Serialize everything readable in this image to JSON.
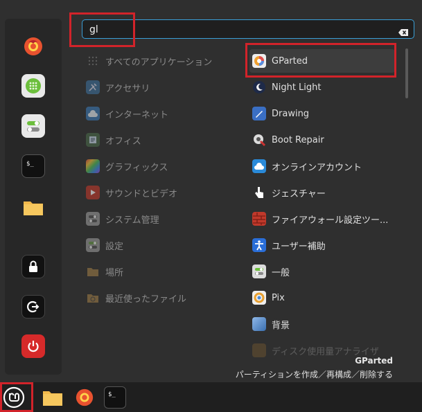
{
  "search": {
    "value": "gl",
    "placeholder": ""
  },
  "categories": [
    {
      "label": "すべてのアプリケーション",
      "icon": "grid-icon"
    },
    {
      "label": "アクセサリ",
      "icon": "accessories-icon"
    },
    {
      "label": "インターネット",
      "icon": "cloud-icon"
    },
    {
      "label": "オフィス",
      "icon": "office-icon"
    },
    {
      "label": "グラフィックス",
      "icon": "graphics-icon"
    },
    {
      "label": "サウンドとビデオ",
      "icon": "play-icon"
    },
    {
      "label": "システム管理",
      "icon": "toggle-icon"
    },
    {
      "label": "設定",
      "icon": "settings-icon"
    },
    {
      "label": "場所",
      "icon": "folder-icon"
    },
    {
      "label": "最近使ったファイル",
      "icon": "recent-folder-icon"
    }
  ],
  "apps": [
    {
      "label": "GParted",
      "icon": "gparted-icon"
    },
    {
      "label": "Night Light",
      "icon": "night-light-icon"
    },
    {
      "label": "Drawing",
      "icon": "drawing-icon"
    },
    {
      "label": "Boot Repair",
      "icon": "boot-repair-icon"
    },
    {
      "label": "オンラインアカウント",
      "icon": "online-accounts-icon"
    },
    {
      "label": "ジェスチャー",
      "icon": "gesture-icon"
    },
    {
      "label": "ファイアウォール設定ツー...",
      "icon": "firewall-icon"
    },
    {
      "label": "ユーザー補助",
      "icon": "accessibility-icon"
    },
    {
      "label": "一般",
      "icon": "general-icon"
    },
    {
      "label": "Pix",
      "icon": "pix-icon"
    },
    {
      "label": "背景",
      "icon": "background-icon"
    },
    {
      "label": "ディスク使用量アナライザ",
      "icon": "disk-usage-icon"
    }
  ],
  "favorites": [
    {
      "icon": "firefox-icon"
    },
    {
      "icon": "software-manager-icon"
    },
    {
      "icon": "system-settings-icon"
    },
    {
      "icon": "terminal-icon"
    },
    {
      "icon": "files-icon"
    },
    {
      "icon": "lock-icon"
    },
    {
      "icon": "logout-icon"
    },
    {
      "icon": "power-icon"
    }
  ],
  "description": {
    "title": "GParted",
    "text": "パーティションを作成／再構成／削除する"
  },
  "taskbar": [
    {
      "icon": "mint-menu-icon"
    },
    {
      "icon": "files-icon"
    },
    {
      "icon": "firefox-icon"
    },
    {
      "icon": "terminal-icon"
    }
  ],
  "colors": {
    "highlight": "#d2232a",
    "accent": "#3aa0d8",
    "panel": "#2f2f2f"
  }
}
